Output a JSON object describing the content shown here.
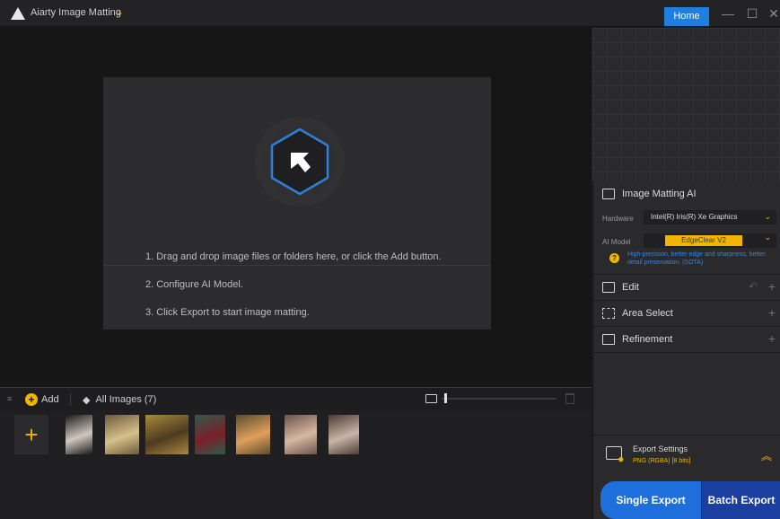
{
  "window": {
    "title": "Aiarty Image Matting",
    "home_label": "Home",
    "controls": {
      "minimize": "—",
      "maximize": "☐",
      "close": "✕"
    }
  },
  "canvas": {
    "instructions": [
      "1. Drag and drop image files or folders here, or click the Add button.",
      "2. Configure AI Model.",
      "3. Click Export to start image matting."
    ]
  },
  "strip": {
    "add_label": "Add",
    "all_images_label": "All Images (7)",
    "add_tile_glyph": "+",
    "zoom_level": 0.02,
    "thumbnails": [
      {
        "icon": "jellyfish-person-thumbnail",
        "colors": [
          "#1a1a1a",
          "#d0c7be"
        ]
      },
      {
        "icon": "birds-thumbnail",
        "colors": [
          "#6b5a3a",
          "#d6c18a"
        ]
      },
      {
        "icon": "bicycle-thumbnail",
        "colors": [
          "#a78a3c",
          "#4f3a20"
        ]
      },
      {
        "icon": "woman-red-dress-thumbnail",
        "colors": [
          "#2e5a4a",
          "#7b1f2a"
        ]
      },
      {
        "icon": "woman-flowers-thumbnail",
        "colors": [
          "#5c4d2e",
          "#e0a05a"
        ]
      },
      {
        "icon": "woman-blossoms-thumbnail",
        "colors": [
          "#6a5448",
          "#d8b7a4"
        ]
      },
      {
        "icon": "woman-roses-thumbnail",
        "colors": [
          "#4a3b34",
          "#c8b4a8"
        ]
      }
    ]
  },
  "panel": {
    "section_title": "Image Matting AI",
    "hardware_label": "Hardware",
    "hardware_value": "Intel(R) Iris(R) Xe Graphics",
    "model_label": "AI Model",
    "model_value": "EdgeClear  V2",
    "model_desc": "High-precision, better edge and sharpness, better detail preservation. (SOTA)",
    "info_glyph": "?",
    "sections": [
      {
        "label": "Edit"
      },
      {
        "label": "Area Select"
      },
      {
        "label": "Refinement"
      }
    ],
    "export_title": "Export Settings",
    "export_format": "PNG (RGBA) [8 bits]",
    "single_export": "Single Export",
    "batch_export": "Batch Export"
  },
  "colors": {
    "accent_yellow": "#f2b400",
    "accent_blue": "#1e7fe0",
    "hex_blue": "#2f7fd6"
  }
}
